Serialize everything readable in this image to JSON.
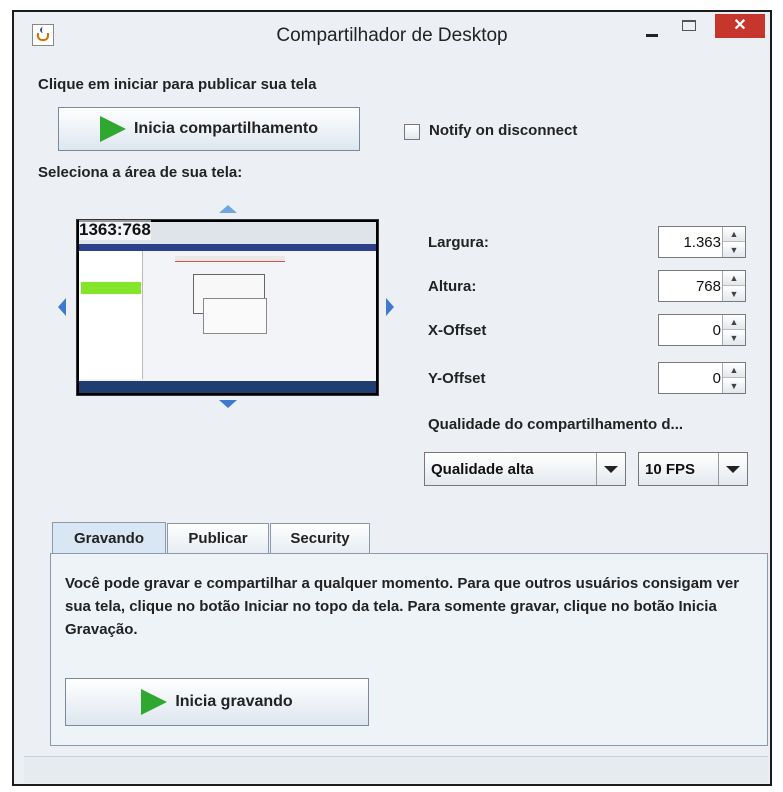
{
  "window": {
    "title": "Compartilhador de Desktop",
    "close_glyph": "✕"
  },
  "publish": {
    "prompt": "Clique em iniciar para publicar sua tela",
    "start_button": "Inicia compartilhamento",
    "notify_label": "Notify on disconnect"
  },
  "area": {
    "prompt": "Seleciona a área de sua tela:",
    "resolution": "1363:768"
  },
  "fields": {
    "width_label": "Largura:",
    "width_value": "1.363",
    "height_label": "Altura:",
    "height_value": "768",
    "xoffset_label": "X-Offset",
    "xoffset_value": "0",
    "yoffset_label": "Y-Offset",
    "yoffset_value": "0"
  },
  "quality": {
    "label": "Qualidade do compartilhamento d...",
    "quality_value": "Qualidade alta",
    "fps_value": "10 FPS"
  },
  "tabs": [
    "Gravando",
    "Publicar",
    "Security"
  ],
  "record": {
    "description": "Você pode gravar e compartilhar a qualquer momento. Para que outros usuários consigam ver sua tela, clique no botão Iniciar no topo da tela. Para somente gravar, clique no botão Inicia Gravação.",
    "record_button": "Inicia gravando"
  },
  "icons": {
    "app": "java-cup-icon",
    "play": "play-icon",
    "arrows": "direction-arrow-icon",
    "spinner": "spinner-arrow-icon"
  },
  "colors": {
    "play_green": "#2ea82e",
    "arrow_blue": "#3f7ad0",
    "close_red": "#c7362c"
  }
}
